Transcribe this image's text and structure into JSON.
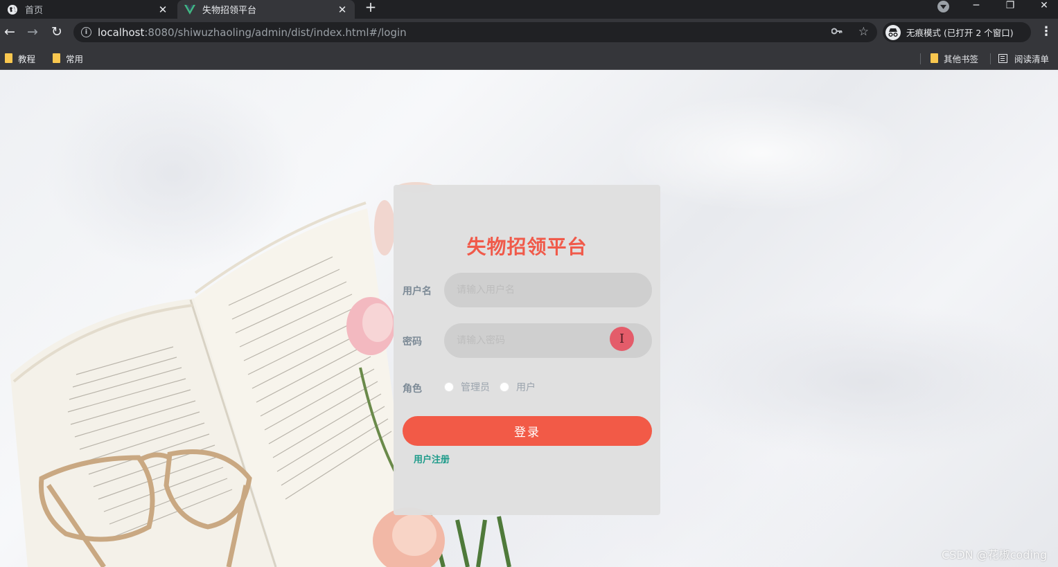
{
  "browser": {
    "tabs": [
      {
        "title": "首页",
        "active": false
      },
      {
        "title": "失物招领平台",
        "active": true
      }
    ],
    "new_tab_label": "+",
    "address": {
      "host": "localhost",
      "path": ":8080/shiwuzhaoling/admin/dist/index.html#/login"
    },
    "incognito_label": "无痕模式 (已打开 2 个窗口)",
    "bookmarks": {
      "left": [
        "教程",
        "常用"
      ],
      "other": "其他书签",
      "reading_list": "阅读清单"
    }
  },
  "login": {
    "title": "失物招领平台",
    "username_label": "用户名",
    "username_placeholder": "请输入用户名",
    "password_label": "密码",
    "password_placeholder": "请输入密码",
    "role_label": "角色",
    "role_options": [
      "管理员",
      "用户"
    ],
    "submit_label": "登录",
    "register_label": "用户注册"
  },
  "cursor_glyph": "I",
  "watermark": "CSDN @花椒coding",
  "colors": {
    "title": "#f05a4a",
    "button": "#f25a47",
    "register_link": "#1d9b8a",
    "card": "#dfdfdf"
  }
}
